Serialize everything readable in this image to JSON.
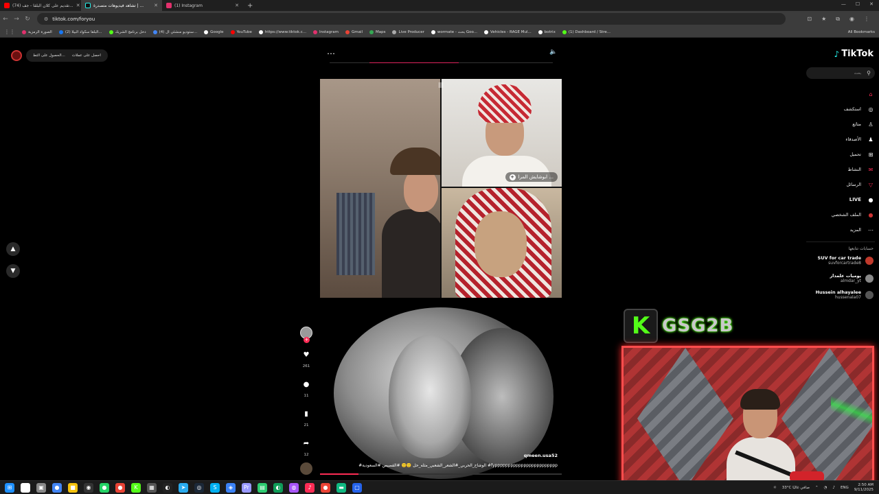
{
  "browser": {
    "tabs": [
      {
        "label": "(74) تقديم على كلان البلقا - جف...",
        "color": "#ff0000"
      },
      {
        "label": "تشاهد فيديوهات متصدرة | ...",
        "color": "#ffffff"
      },
      {
        "label": "(1) Instagram",
        "color": "#e1306c"
      }
    ],
    "new_tab": "+",
    "url": "tiktok.com/foryou",
    "bookmarks": [
      {
        "label": "الصورة الرمزية",
        "color": "#e1306c"
      },
      {
        "label": "(2) البلقا سكواد البيلا...",
        "color": "#1877f2"
      },
      {
        "label": "دخل برنامج الشريك",
        "color": "#53fc18"
      },
      {
        "label": "(4) ستوديو منشئي ال...",
        "color": "#4285f4"
      },
      {
        "label": "Google",
        "color": "#ffffff"
      },
      {
        "label": "YouTube",
        "color": "#ff0000"
      },
      {
        "label": "https://www.tiktok.c...",
        "color": "#ffffff"
      },
      {
        "label": "Instagram",
        "color": "#e1306c"
      },
      {
        "label": "Gmail",
        "color": "#ea4335"
      },
      {
        "label": "Maps",
        "color": "#34a853"
      },
      {
        "label": "Live Producer",
        "color": "#aaaaaa"
      },
      {
        "label": "wormate - بحث Goo...",
        "color": "#ffffff"
      },
      {
        "label": "Vehicles - RAGE Mul...",
        "color": "#ffffff"
      },
      {
        "label": "botrix",
        "color": "#ffffff"
      },
      {
        "label": "(1) Dashboard / Stre...",
        "color": "#53fc18"
      }
    ],
    "all_bookmarks": "All Bookmarks"
  },
  "tiktok": {
    "coins_label": "احصل على عملات",
    "app_label": "الحصول على التط...",
    "logo": "TikTok",
    "search_placeholder": "بحث",
    "nav": [
      {
        "label": "",
        "icon": "home-icon",
        "glyph": "⌂",
        "color": "#fe2c55"
      },
      {
        "label": "استكشف",
        "icon": "compass-icon",
        "glyph": "◎",
        "color": "#ffffff"
      },
      {
        "label": "متابَع",
        "icon": "following-icon",
        "glyph": "♙",
        "color": "#ffffff"
      },
      {
        "label": "الأصدقاء",
        "icon": "friends-icon",
        "glyph": "♟",
        "color": "#ffffff"
      },
      {
        "label": "تحميل",
        "icon": "upload-icon",
        "glyph": "⊞",
        "color": "#ffffff"
      },
      {
        "label": "النشاط",
        "icon": "activity-icon",
        "glyph": "✉",
        "color": "#fe2c55"
      },
      {
        "label": "الرسائل",
        "icon": "messages-icon",
        "glyph": "▽",
        "color": "#fe2c55"
      },
      {
        "label": "LIVE",
        "icon": "live-icon",
        "glyph": "●",
        "color": "#ffffff"
      },
      {
        "label": "الملف الشخصي",
        "icon": "profile-icon",
        "glyph": "●",
        "color": "#c33"
      },
      {
        "label": "المزيد",
        "icon": "more-icon",
        "glyph": "⋯",
        "color": "#ffffff"
      }
    ],
    "following_title": "حسابات تتابعها",
    "accounts": [
      {
        "name": "SUV for car trade",
        "handle": "suvforcartrade8",
        "color": "#c0392b"
      },
      {
        "name": "يوميات علمدار",
        "handle": "almdar_yt",
        "color": "#888888"
      },
      {
        "name": "Hussein alhayalee",
        "handle": "hussenala07",
        "color": "#555555"
      }
    ],
    "video1": {
      "participant_name": "ابوشايش المرا ..."
    },
    "video2": {
      "likes": "261",
      "comments": "11",
      "saves": "21",
      "shares": "12",
      "username": "qmeen.usa52",
      "caption": "#الوشاح_الحربي_#الشعر_الشعبي_مثله_حل 🙂🙂 #القصيص #السعودية #fypppppppppppppppppppppppp"
    }
  },
  "stream_overlay": {
    "channel": "GSG2B",
    "badge_letter": "K"
  },
  "taskbar": {
    "weather": "33°C صافي غالبًا",
    "lang": "ENG",
    "time": "2:50 AM",
    "date": "9/11/2025"
  }
}
